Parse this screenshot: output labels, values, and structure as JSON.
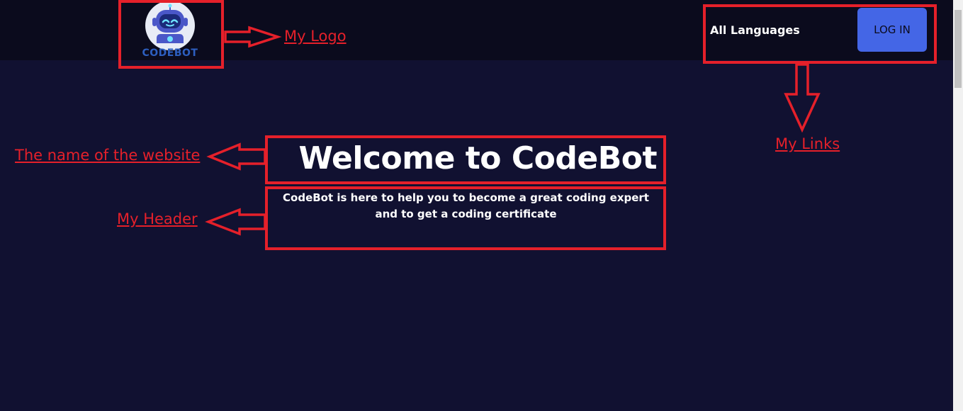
{
  "navbar": {
    "logo_text": "CODEBOT",
    "links": [
      {
        "label": "All Languages"
      }
    ],
    "login_label": "LOG IN"
  },
  "hero": {
    "title": "Welcome to CodeBot",
    "text_line1": "CodeBot is here to help you to become a great coding expert",
    "text_line2": "and to get a coding certificate"
  },
  "annotations": {
    "logo": "My Logo",
    "links": "My Links",
    "website_name": "The name of the website",
    "header": "My Header"
  },
  "colors": {
    "page_background": "#111131",
    "navbar_background": "#0b0b1d",
    "button_accent": "#4466e6",
    "annotation_red": "#e5202a"
  }
}
